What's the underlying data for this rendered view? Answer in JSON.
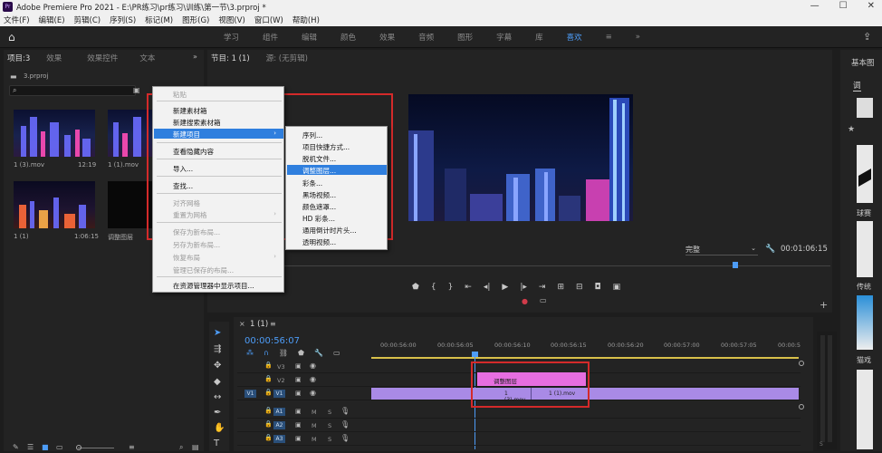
{
  "window": {
    "title": "Adobe Premiere Pro 2021 - E:\\PR练习\\pr练习\\训练\\第一节\\3.prproj *",
    "app_badge": "Pr"
  },
  "menu": [
    "文件(F)",
    "编辑(E)",
    "剪辑(C)",
    "序列(S)",
    "标记(M)",
    "图形(G)",
    "视图(V)",
    "窗口(W)",
    "帮助(H)"
  ],
  "workspaces": [
    {
      "label": "学习",
      "active": false
    },
    {
      "label": "组件",
      "active": false
    },
    {
      "label": "编辑",
      "active": false
    },
    {
      "label": "颜色",
      "active": false
    },
    {
      "label": "效果",
      "active": false
    },
    {
      "label": "音频",
      "active": false
    },
    {
      "label": "图形",
      "active": false
    },
    {
      "label": "字幕",
      "active": false
    },
    {
      "label": "库",
      "active": false
    },
    {
      "label": "喜欢",
      "active": true
    }
  ],
  "project_panel": {
    "tabs": [
      "项目:3",
      "效果",
      "效果控件",
      "文本"
    ],
    "file_name": "3.prproj",
    "items": [
      {
        "name": "1 (3).mov",
        "duration": "12:19"
      },
      {
        "name": "1 (1).mov",
        "duration": ""
      },
      {
        "name": "1 (1)",
        "duration": "1:06:15"
      },
      {
        "name": "调整图层",
        "duration": ""
      }
    ]
  },
  "context_menu": {
    "items": [
      {
        "label": "粘贴",
        "disabled": true
      },
      {
        "label": "新建素材箱",
        "disabled": false
      },
      {
        "label": "新建搜索素材箱",
        "disabled": false
      },
      {
        "label": "新建项目",
        "disabled": false,
        "highlighted": true,
        "submenu": true
      },
      {
        "label": "查看隐藏内容",
        "disabled": false
      },
      {
        "label": "导入...",
        "disabled": false
      },
      {
        "label": "查找...",
        "disabled": false
      },
      {
        "label": "对齐网格",
        "disabled": true
      },
      {
        "label": "重置为网格",
        "disabled": true,
        "submenu": true
      },
      {
        "label": "保存为新布局...",
        "disabled": true
      },
      {
        "label": "另存为新布局...",
        "disabled": true
      },
      {
        "label": "恢复布局",
        "disabled": true,
        "submenu": true
      },
      {
        "label": "管理已保存的布局...",
        "disabled": true
      },
      {
        "label": "在资源管理器中显示项目...",
        "disabled": false
      }
    ]
  },
  "submenu": {
    "items": [
      {
        "label": "序列...",
        "highlighted": false
      },
      {
        "label": "项目快捷方式...",
        "highlighted": false
      },
      {
        "label": "脱机文件...",
        "highlighted": false
      },
      {
        "label": "调整图层...",
        "highlighted": true
      },
      {
        "label": "彩条...",
        "highlighted": false
      },
      {
        "label": "黑场视频...",
        "highlighted": false
      },
      {
        "label": "颜色遮罩...",
        "highlighted": false
      },
      {
        "label": "HD 彩条...",
        "highlighted": false
      },
      {
        "label": "通用倒计时片头...",
        "highlighted": false
      },
      {
        "label": "透明视频...",
        "highlighted": false
      }
    ]
  },
  "program_monitor": {
    "tabs": [
      "节目: 1 (1)",
      "源: (无剪辑)"
    ],
    "quality": "完整",
    "timecode": "00:01:06:15"
  },
  "timeline": {
    "tab": "1 (1)",
    "timecode": "00:00:56:07",
    "ruler": [
      "00:00:56:00",
      "00:00:56:05",
      "00:00:56:10",
      "00:00:56:15",
      "00:00:56:20",
      "00:00:57:00",
      "00:00:57:05",
      "00:00:5"
    ],
    "video_tracks": [
      "V3",
      "V2",
      "V1"
    ],
    "audio_tracks": [
      "A1",
      "A2",
      "A3"
    ],
    "source_patch": "V1",
    "clips": {
      "adjustment": "调整图层",
      "clip_a": "1 (3).mov",
      "clip_b": "1 (1).mov"
    },
    "track_letters": {
      "mute": "M",
      "solo": "S"
    }
  },
  "right_panel": {
    "tab": "基本图",
    "label_1": "调",
    "label_2": "球赛",
    "label_3": "传统",
    "label_4": "猫戏"
  },
  "colors": {
    "accent": "#4d9cf7",
    "highlight": "#2f7fde",
    "adjustment_clip": "#e66ee0",
    "video_clip": "#a98ae6",
    "annotation": "#d42a2a"
  }
}
